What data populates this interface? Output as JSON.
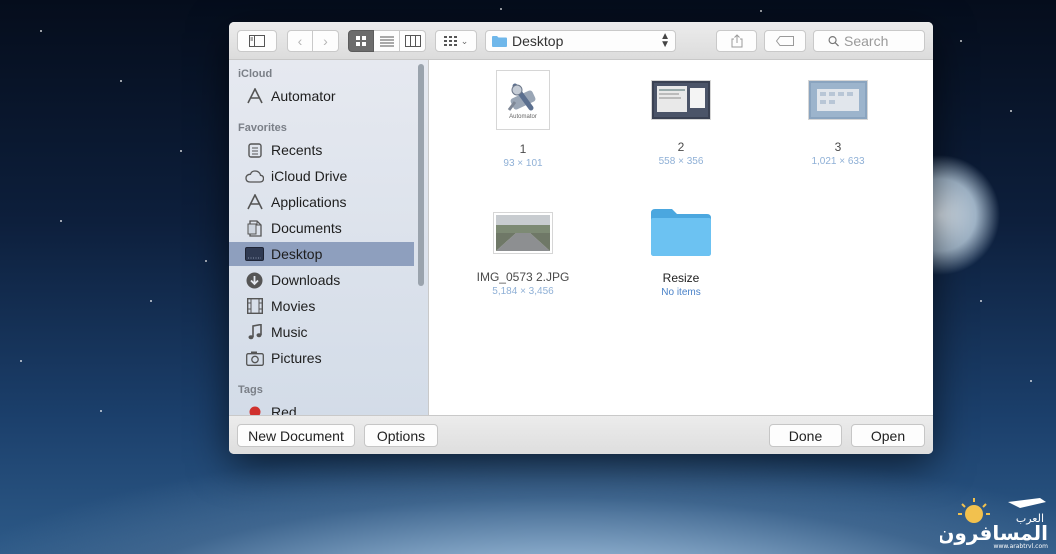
{
  "toolbar": {
    "path_label": "Desktop",
    "search_placeholder": "Search"
  },
  "sidebar": {
    "sections": [
      {
        "heading": "iCloud",
        "items": [
          {
            "label": "Automator",
            "icon": "automator-icon"
          }
        ]
      },
      {
        "heading": "Favorites",
        "items": [
          {
            "label": "Recents",
            "icon": "recents-icon"
          },
          {
            "label": "iCloud Drive",
            "icon": "cloud-icon"
          },
          {
            "label": "Applications",
            "icon": "applications-icon"
          },
          {
            "label": "Documents",
            "icon": "documents-icon"
          },
          {
            "label": "Desktop",
            "icon": "desktop-icon",
            "selected": true
          },
          {
            "label": "Downloads",
            "icon": "downloads-icon"
          },
          {
            "label": "Movies",
            "icon": "movies-icon"
          },
          {
            "label": "Music",
            "icon": "music-icon"
          },
          {
            "label": "Pictures",
            "icon": "pictures-icon"
          }
        ]
      },
      {
        "heading": "Tags",
        "items": [
          {
            "label": "Red",
            "icon": "red-tag-icon"
          }
        ]
      }
    ]
  },
  "files": [
    {
      "name": "1",
      "sub": "93 × 101",
      "thumb_label": "Automator"
    },
    {
      "name": "2",
      "sub": "558 × 356"
    },
    {
      "name": "3",
      "sub": "1,021 × 633"
    },
    {
      "name": "IMG_0573 2.JPG",
      "sub": "5,184 × 3,456"
    },
    {
      "name": "Resize",
      "sub": "No items"
    }
  ],
  "footer": {
    "new_document": "New Document",
    "options": "Options",
    "done": "Done",
    "open": "Open"
  },
  "watermark": {
    "text_large": "المسافرون",
    "text_small": "العرب",
    "url": "www.arabtrvl.com"
  },
  "colors": {
    "selection": "#8e9fbe",
    "folder_blue": "#5bb8ec",
    "sub_blue": "#8fb0d6"
  }
}
